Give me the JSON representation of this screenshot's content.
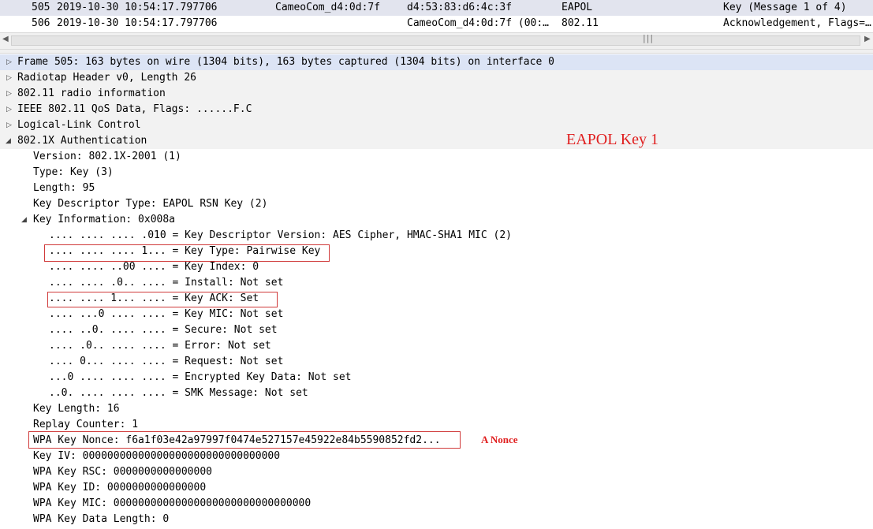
{
  "packet_list": {
    "rows": [
      {
        "no": "505",
        "time": "2019-10-30 10:54:17.797706",
        "source": "CameoCom_d4:0d:7f",
        "destination": "d4:53:83:d6:4c:3f",
        "protocol": "EAPOL",
        "info": "Key (Message 1 of 4)"
      },
      {
        "no": "506",
        "time": "2019-10-30 10:54:17.797706",
        "source": "",
        "destination": "CameoCom_d4:0d:7f (00:…",
        "protocol": "802.11",
        "info": "Acknowledgement, Flags=…"
      }
    ],
    "scrollbar_grip": "|||"
  },
  "details": {
    "frame": "Frame 505: 163 bytes on wire (1304 bits), 163 bytes captured (1304 bits) on interface 0",
    "radiotap": "Radiotap Header v0, Length 26",
    "radio_info": "802.11 radio information",
    "ieee": "IEEE 802.11 QoS Data, Flags: ......F.C",
    "llc": "Logical-Link Control",
    "auth": "802.1X Authentication",
    "version": "Version: 802.1X-2001 (1)",
    "type": "Type: Key (3)",
    "length": "Length: 95",
    "descriptor_type": "Key Descriptor Type: EAPOL RSN Key (2)",
    "key_info": "Key Information: 0x008a",
    "key_info_bits": [
      ".... .... .... .010 = Key Descriptor Version: AES Cipher, HMAC-SHA1 MIC (2)",
      ".... .... .... 1... = Key Type: Pairwise Key",
      ".... .... ..00 .... = Key Index: 0",
      ".... .... .0.. .... = Install: Not set",
      ".... .... 1... .... = Key ACK: Set",
      ".... ...0 .... .... = Key MIC: Not set",
      ".... ..0. .... .... = Secure: Not set",
      ".... .0.. .... .... = Error: Not set",
      ".... 0... .... .... = Request: Not set",
      "...0 .... .... .... = Encrypted Key Data: Not set",
      "..0. .... .... .... = SMK Message: Not set"
    ],
    "key_length": "Key Length: 16",
    "replay_counter": "Replay Counter: 1",
    "nonce": "WPA Key Nonce: f6a1f03e42a97997f0474e527157e45922e84b5590852fd2...",
    "key_iv": "Key IV: 00000000000000000000000000000000",
    "key_rsc": "WPA Key RSC: 0000000000000000",
    "key_id": "WPA Key ID: 0000000000000000",
    "key_mic": "WPA Key MIC: 00000000000000000000000000000000",
    "key_data_length": "WPA Key Data Length: 0"
  },
  "annotations": {
    "eapol_key": "EAPOL Key 1",
    "a_nonce": "A Nonce",
    "color": "#e02020"
  }
}
